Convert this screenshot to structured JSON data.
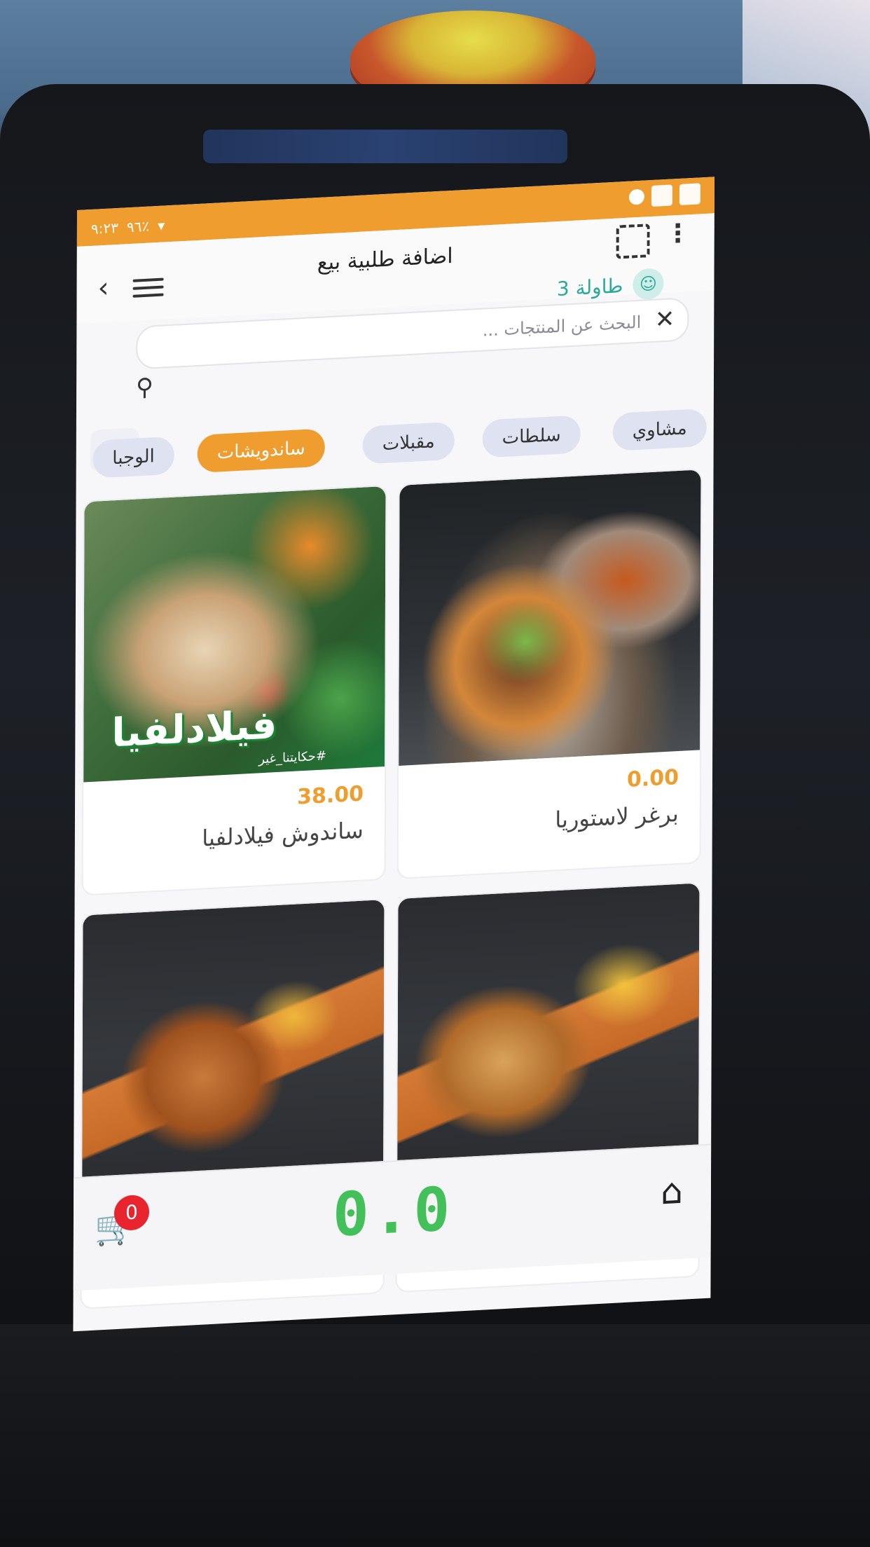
{
  "status_bar": {
    "time": "٩:٢٣",
    "battery": "٩٦٪"
  },
  "header": {
    "title": "اضافة طلبية بيع",
    "table_label": "طاولة 3"
  },
  "search": {
    "placeholder": "البحث عن المنتجات ..."
  },
  "categories": [
    {
      "label": "مشاوي",
      "active": false
    },
    {
      "label": "سلطات",
      "active": false
    },
    {
      "label": "مقبلات",
      "active": false
    },
    {
      "label": "ساندويشات",
      "active": true
    },
    {
      "label": "الوجبا",
      "active": false
    }
  ],
  "products": [
    {
      "name": "برغر لاستوريا",
      "price": "0.00"
    },
    {
      "name": "ساندوش فيلادلفيا",
      "price": "38.00"
    },
    {
      "name": "",
      "price": ""
    },
    {
      "name": "",
      "price": ""
    }
  ],
  "image_text": {
    "brand": "فيلادلفيا",
    "hashtag": "#حكايتنا_غير"
  },
  "footer": {
    "cart_count": "0",
    "total": "0.0"
  },
  "colors": {
    "accent": "#ef9d2f",
    "teal": "#2aa99b",
    "total_green": "#43c05a",
    "badge_red": "#e8242f"
  },
  "icons": [
    "back-icon",
    "menu-icon",
    "scan-icon",
    "more-icon",
    "user-icon",
    "close-icon",
    "search-icon",
    "sort-icon",
    "cart-icon",
    "home-icon"
  ]
}
